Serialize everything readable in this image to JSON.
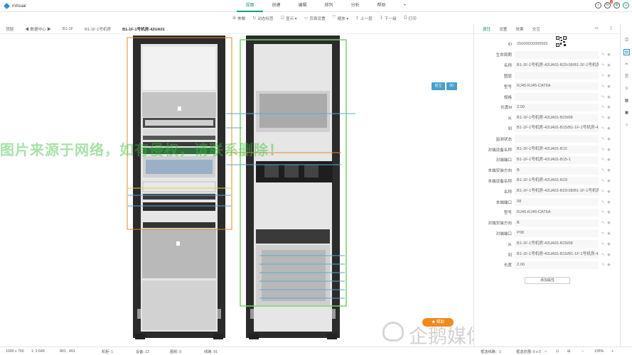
{
  "app": {
    "name": "nVisual"
  },
  "nav": [
    "视图",
    "创建",
    "编辑",
    "排列",
    "分析",
    "帮助"
  ],
  "nav_plus": "+",
  "notif_count": "2",
  "toolbar": [
    {
      "icon": "⊕",
      "label": "佈餐"
    },
    {
      "icon": "↻",
      "label": "动态标签"
    },
    {
      "icon": "☑",
      "label": "显示 ▾"
    },
    {
      "icon": "▭",
      "label": "页面设置"
    },
    {
      "icon": "⤧",
      "label": "缩放 ▾"
    },
    {
      "icon": "↥",
      "label": "上一层"
    },
    {
      "icon": "↧",
      "label": "下一级"
    },
    {
      "icon": "⎙",
      "label": "打印"
    }
  ],
  "breadcrumb": [
    "顶层",
    "◀ 数据中心 ▶",
    "B1-1F",
    "B1-1F-1号机房",
    "B1-1F-1号机房-42UA01"
  ],
  "view_buttons": [
    "前立",
    "3D"
  ],
  "watermark": "图片来源于网络，如有侵权，请联系删除！",
  "watermark2": "企鹅媒体平台 nVisual",
  "help": "★ 帮助",
  "status": {
    "resolution": "1000 x 750",
    "scale": "1: 2.649",
    "coords": "801 , 491",
    "cabinet": "机柜: 1",
    "device": "设备: 12",
    "shape": "图纸: 0",
    "line": "线路: 91",
    "selected": "框选线路：1",
    "selected_range": "框选范围: 0 x 0",
    "zoom": "135%"
  },
  "panel": {
    "tabs": [
      "属性",
      "设置",
      "效果",
      "交互"
    ],
    "rows": [
      {
        "label": "ID",
        "value": "25000000000565",
        "plain": true
      },
      {
        "label": "生命周期",
        "value": ""
      },
      {
        "label": "名称",
        "value": "B1-1F-1号机房-42UA01-B29:08/B1-1F-1号机房-"
      },
      {
        "label": "图层",
        "value": ""
      },
      {
        "label": "型号",
        "value": "RJ45-RJ45-CAT6A"
      },
      {
        "label": "规格",
        "value": ""
      },
      {
        "label": "长度M",
        "value": "2.00"
      },
      {
        "label": "从",
        "value": "B1-1F-1号机房-42UA01-B29/08"
      },
      {
        "label": "到",
        "value": "B1-1F-1号机房-42UA01-B15/B1-1F-1号机房-42L"
      },
      {
        "label": "监测状态",
        "value": ""
      },
      {
        "label": "对端设备名称",
        "value": "B1-1F-1号机房-42UA01-B15"
      },
      {
        "label": "对端端口",
        "value": "B1-1F-1号机房-42UA01-B15-1"
      },
      {
        "label": "本端安装方向",
        "value": "B"
      },
      {
        "label": "本端设备名称",
        "value": "B1-1F-1号机房-42UA01-B29"
      },
      {
        "label": "名称",
        "value": "B1-1F-1号机房-42UA01-B29:08/B1-1F-1号机房-"
      },
      {
        "label": "本端端口",
        "value": "08"
      },
      {
        "label": "型号",
        "value": "RJ45-RJ45-CAT6A"
      },
      {
        "label": "对端安装方向",
        "value": "B"
      },
      {
        "label": "对端端口",
        "value": "P08"
      },
      {
        "label": "从",
        "value": "B1-1F-1号机房-42UA01-B29/08"
      },
      {
        "label": "到",
        "value": "B1-1F-1号机房-42UA01-B15/B1-1F-1号机房-42L"
      },
      {
        "label": "长度",
        "value": "2.00"
      }
    ],
    "add_label": "添加属性"
  }
}
